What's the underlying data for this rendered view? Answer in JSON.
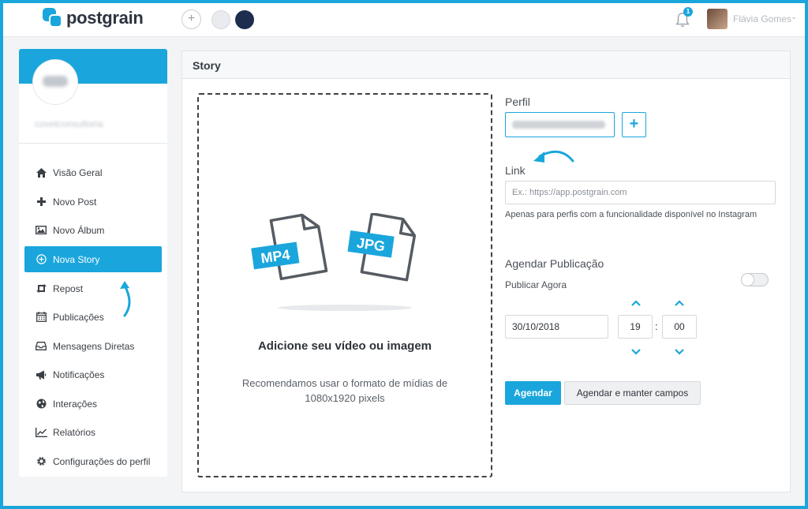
{
  "app": {
    "name": "postgrain"
  },
  "topbar": {
    "notification_count": "1",
    "user_name": "Flávia Gomes"
  },
  "sidebar": {
    "profile_name": "covetconsultoria",
    "items": [
      {
        "label": "Visão Geral",
        "icon": "home-icon"
      },
      {
        "label": "Novo Post",
        "icon": "plus-icon"
      },
      {
        "label": "Novo Álbum",
        "icon": "image-icon"
      },
      {
        "label": "Nova Story",
        "icon": "plus-circle-icon",
        "active": true
      },
      {
        "label": "Repost",
        "icon": "repost-icon"
      },
      {
        "label": "Publicações",
        "icon": "calendar-icon"
      },
      {
        "label": "Mensagens Diretas",
        "icon": "inbox-icon"
      },
      {
        "label": "Notificações",
        "icon": "megaphone-icon"
      },
      {
        "label": "Interações",
        "icon": "globe-icon"
      },
      {
        "label": "Relatórios",
        "icon": "chart-icon"
      },
      {
        "label": "Configurações do perfil",
        "icon": "gear-icon"
      }
    ]
  },
  "panel": {
    "title": "Story",
    "dropzone": {
      "file_types": [
        "MP4",
        "JPG"
      ],
      "title": "Adicione seu vídeo ou imagem",
      "subtitle": "Recomendamos usar o formato de mídias de 1080x1920 pixels"
    },
    "form": {
      "profile_label": "Perfil",
      "link_label": "Link",
      "link_placeholder": "Ex.: https://app.postgrain.com",
      "link_help": "Apenas para perfis com a funcionalidade disponível no Instagram",
      "schedule_label": "Agendar Publicação",
      "publish_now_label": "Publicar Agora",
      "publish_now_on": false,
      "date": "30/10/2018",
      "hour": "19",
      "minute": "00",
      "time_separator": ":",
      "schedule_button": "Agendar",
      "schedule_keep_button": "Agendar e manter campos"
    }
  },
  "colors": {
    "accent": "#1aa6dc",
    "text": "#2f343a",
    "border": "#d5d9de"
  }
}
